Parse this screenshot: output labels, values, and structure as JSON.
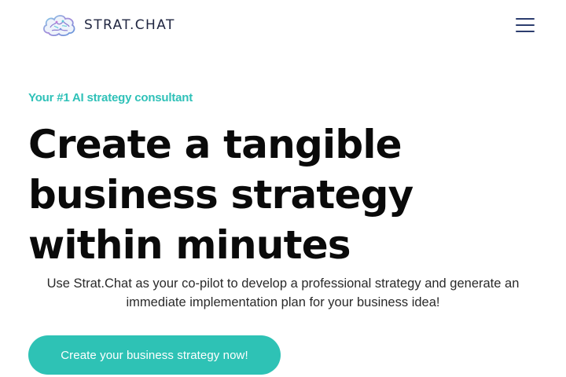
{
  "header": {
    "logo_text": "STRAT.CHAT",
    "logo_icon": "brain-cloud-icon",
    "menu_icon": "hamburger-menu-icon"
  },
  "hero": {
    "eyebrow": "Your #1 AI strategy consultant",
    "headline": "Create a tangible business strategy within minutes",
    "subtext": "Use Strat.Chat as your co-pilot to develop a professional strategy and generate an immediate implementation plan for your business idea!",
    "cta_label": "Create your business strategy now!"
  },
  "colors": {
    "accent": "#2ec2b5",
    "eyebrow": "#2fc1b8",
    "menu_icon": "#2c3d6e",
    "logo_text": "#1f2540",
    "headline": "#0a0a0a"
  }
}
